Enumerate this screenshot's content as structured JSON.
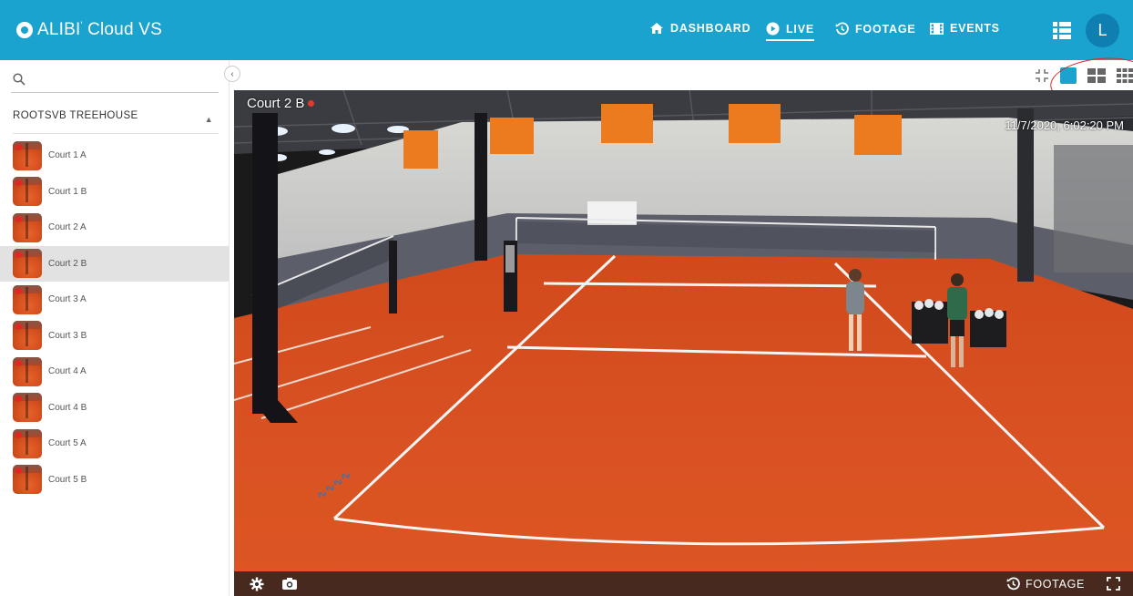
{
  "app": {
    "brand": "ALIBI",
    "brand_suffix": "Cloud VS"
  },
  "nav": {
    "dashboard": "DASHBOARD",
    "live": "LIVE",
    "footage": "FOOTAGE",
    "events": "EVENTS",
    "active": "LIVE",
    "avatar_initial": "L"
  },
  "sidebar": {
    "search_placeholder": "",
    "group_name": "ROOTSVB TREEHOUSE",
    "cameras": [
      {
        "label": "Court 1 A",
        "recording": true
      },
      {
        "label": "Court 1 B",
        "recording": true
      },
      {
        "label": "Court 2 A",
        "recording": true
      },
      {
        "label": "Court 2 B",
        "recording": true,
        "selected": true
      },
      {
        "label": "Court 3 A",
        "recording": true
      },
      {
        "label": "Court 3 B",
        "recording": true
      },
      {
        "label": "Court 4 A",
        "recording": true
      },
      {
        "label": "Court 4 B",
        "recording": true
      },
      {
        "label": "Court 5 A",
        "recording": true
      },
      {
        "label": "Court 5 B",
        "recording": true
      }
    ]
  },
  "viewer": {
    "camera_title": "Court 2 B",
    "timestamp": "11/7/2020, 6:02:20 PM",
    "footage_label": "FOOTAGE",
    "layout_selected": "single"
  },
  "colors": {
    "brand": "#1aa3cf",
    "recording": "#e23b2c",
    "annotation": "#d42a2a"
  }
}
